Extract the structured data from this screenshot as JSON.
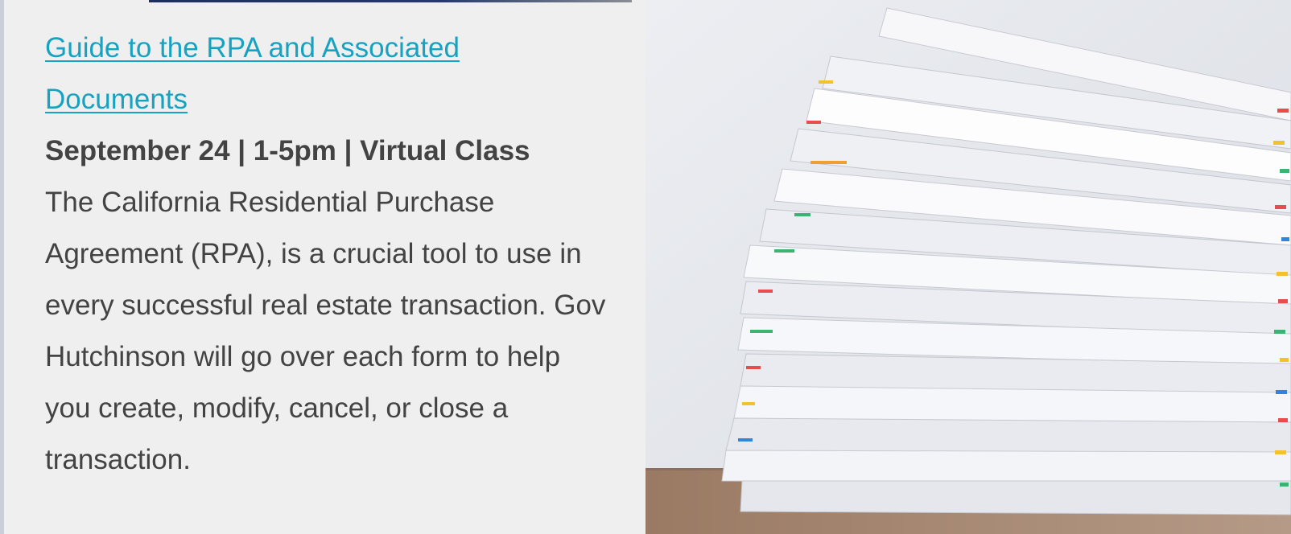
{
  "event": {
    "title": "Guide to the RPA and Associated Documents",
    "meta": "September 24 | 1-5pm | Virtual Class",
    "description": "The California Residential Purchase Agreement (RPA), is a crucial tool to use in every successful real estate transaction. Gov Hutchinson will go over each form to help you create, modify, cancel, or close a transaction."
  },
  "image": {
    "subject": "stacked-paper-documents-photo"
  },
  "colors": {
    "background": "#efefef",
    "link": "#18a2c2",
    "text": "#434343",
    "accent_strip": "#1c2f5c"
  }
}
